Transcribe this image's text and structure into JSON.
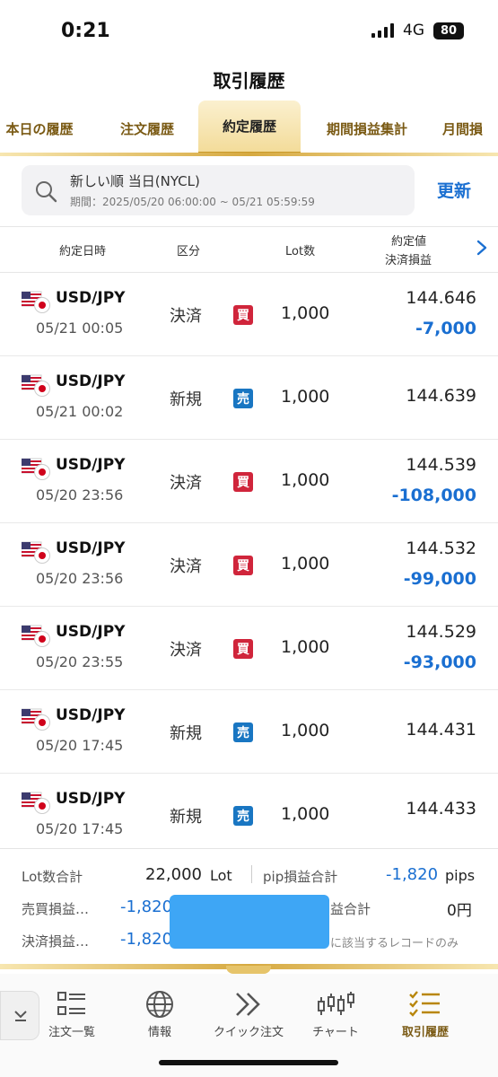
{
  "status_bar": {
    "time": "0:21",
    "network": "4G",
    "battery": "80"
  },
  "header": {
    "title": "取引履歴"
  },
  "tabs": [
    {
      "label": "本日の履歴"
    },
    {
      "label": "注文履歴"
    },
    {
      "label": "約定履歴"
    },
    {
      "label": "期間損益集計"
    },
    {
      "label": "月間損"
    }
  ],
  "filter": {
    "summary": "新しい順 当日(NYCL)",
    "period": "期間：2025/05/20 06:00:00 ~ 05/21 05:59:59",
    "refresh_label": "更新"
  },
  "table": {
    "headers": {
      "datetime": "約定日時",
      "type": "区分",
      "lot": "Lot数",
      "price": "約定値",
      "pl": "決済損益"
    },
    "rows": [
      {
        "pair": "USD/JPY",
        "datetime": "05/21 00:05",
        "type": "決済",
        "side": "買",
        "lot": "1,000",
        "price": "144.646",
        "pl": "-7,000"
      },
      {
        "pair": "USD/JPY",
        "datetime": "05/21 00:02",
        "type": "新規",
        "side": "売",
        "lot": "1,000",
        "price": "144.639",
        "pl": ""
      },
      {
        "pair": "USD/JPY",
        "datetime": "05/20 23:56",
        "type": "決済",
        "side": "買",
        "lot": "1,000",
        "price": "144.539",
        "pl": "-108,000"
      },
      {
        "pair": "USD/JPY",
        "datetime": "05/20 23:56",
        "type": "決済",
        "side": "買",
        "lot": "1,000",
        "price": "144.532",
        "pl": "-99,000"
      },
      {
        "pair": "USD/JPY",
        "datetime": "05/20 23:55",
        "type": "決済",
        "side": "買",
        "lot": "1,000",
        "price": "144.529",
        "pl": "-93,000"
      },
      {
        "pair": "USD/JPY",
        "datetime": "05/20 17:45",
        "type": "新規",
        "side": "売",
        "lot": "1,000",
        "price": "144.431",
        "pl": ""
      },
      {
        "pair": "USD/JPY",
        "datetime": "05/20 17:45",
        "type": "新規",
        "side": "売",
        "lot": "1,000",
        "price": "144.433",
        "pl": ""
      }
    ]
  },
  "summary": {
    "lot_total_label": "Lot数合計",
    "lot_total_value": "22,000",
    "lot_unit": "Lot",
    "pip_total_label": "pip損益合計",
    "pip_total_value": "-1,820",
    "pip_unit": "pips",
    "trade_pl_label": "売買損益…",
    "trade_pl_value": "-1,820",
    "swap_label": "益合計",
    "swap_value": "0円",
    "settle_pl_label": "決済損益…",
    "settle_pl_value": "-1,820",
    "note": "に該当するレコードのみ"
  },
  "nav": [
    {
      "label": "注文一覧",
      "icon": "order-list-icon"
    },
    {
      "label": "情報",
      "icon": "globe-icon"
    },
    {
      "label": "クイック注文",
      "icon": "double-chevron-icon"
    },
    {
      "label": "チャート",
      "icon": "candlestick-icon"
    },
    {
      "label": "取引履歴",
      "icon": "history-checklist-icon"
    }
  ],
  "colors": {
    "accent_gold": "#c99a2a",
    "loss_blue": "#1a6fd1",
    "buy_red": "#d0253b",
    "sell_blue": "#1976c2"
  }
}
